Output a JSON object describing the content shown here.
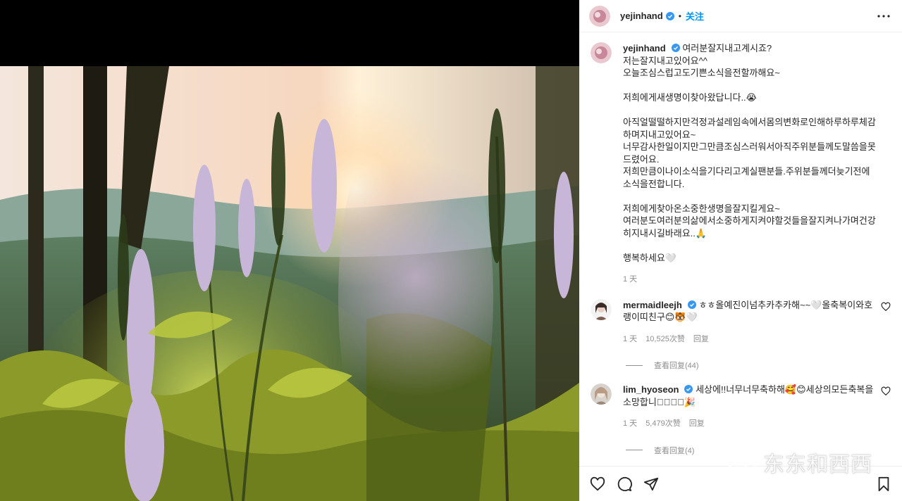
{
  "post_author": {
    "username": "yejinhand",
    "verified": true,
    "separator": "•",
    "follow_label": "关注"
  },
  "caption": {
    "username": "yejinhand",
    "text": "여러분잘지내고계시죠?\n저는잘지내고있어요^^\n오늘조심스럽고도기쁜소식을전할까해요~\n\n저희에게새생명이찾아왔답니다..😭\n\n아직얼떨떨하지만걱정과설레임속에서몸의변화로인해하루하루체감하며지내고있어요~\n너무감사한일이지만그만큼조심스러워서아직주위분들께도말씀을못드렸어요.\n저희만큼이나이소식을기다리고계실팬분들.주위분들께더늦기전에소식을전합니다.\n\n저희에게찾아온소중한생명을잘지킬게요~\n여러분도여러분의삶에서소중하게지켜야할것들을잘지켜나가며건강히지내시길바래요..🙏\n\n행복하세요🤍",
    "time": "1 天"
  },
  "comments": [
    {
      "username": "mermaidleejh",
      "verified": true,
      "text": "ㅎㅎ올예진이넘추카추카해~~🤍올축복이와호랭이띠친구😊🐯🤍",
      "time": "1 天",
      "likes": "10,525次赞",
      "reply_label": "回复",
      "view_replies": "查看回复(44)"
    },
    {
      "username": "lim_hyoseon",
      "verified": true,
      "text": "세상에!!너무너무축하해🥰😊세상의모든축복을소망합니다🏻🏻🏻🎉",
      "time": "1 天",
      "likes": "5,479次赞",
      "reply_label": "回复",
      "view_replies": "查看回复(4)"
    }
  ],
  "actions": {
    "like": "heart-icon",
    "comment": "comment-icon",
    "share": "paper-plane-icon",
    "save": "bookmark-icon"
  },
  "watermark": {
    "text": "东东和西西"
  },
  "colors": {
    "accent": "#0095f6",
    "verified": "#3897f0",
    "muted": "#8e8e8e",
    "text": "#262626"
  }
}
